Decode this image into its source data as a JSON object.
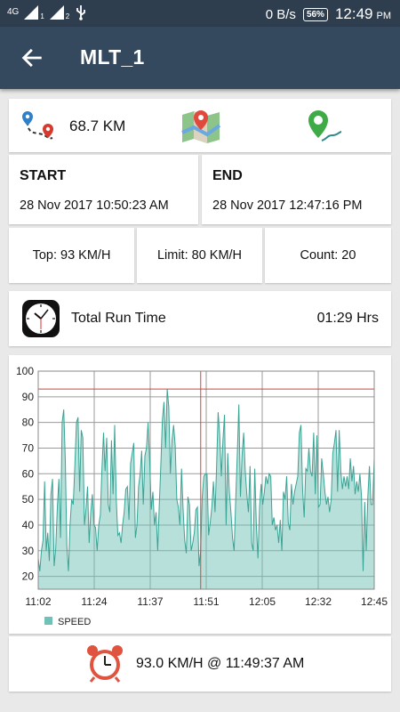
{
  "status_bar": {
    "network": "4G",
    "sim1": "1",
    "sim2": "2",
    "data_rate": "0 B/s",
    "battery": "56%",
    "time": "12:49",
    "ampm": "PM"
  },
  "app_bar": {
    "title": "MLT_1",
    "back_icon": "arrow-left-icon"
  },
  "summary": {
    "distance": "68.7 KM",
    "route_icon": "route-pins-icon",
    "map_icon": "map-pin-icon",
    "location_icon": "location-path-icon"
  },
  "trip": {
    "start_label": "START",
    "start_time": "28 Nov 2017 10:50:23 AM",
    "end_label": "END",
    "end_time": "28 Nov 2017 12:47:16 PM"
  },
  "stats": {
    "top": "Top: 93 KM/H",
    "limit": "Limit: 80 KM/H",
    "count": "Count: 20"
  },
  "run_time": {
    "label": "Total Run Time",
    "value": "01:29 Hrs",
    "icon": "clock-icon"
  },
  "chart_data": {
    "type": "area",
    "series": [
      {
        "name": "SPEED",
        "color": "#6fc2b5"
      }
    ],
    "x_ticks": [
      "11:02",
      "11:24",
      "11:37",
      "11:51",
      "12:05",
      "12:32",
      "12:45"
    ],
    "y_ticks": [
      20,
      30,
      40,
      50,
      60,
      70,
      80,
      90,
      100
    ],
    "ylim": [
      15,
      100
    ],
    "limit_line": 93,
    "marker_x": "11:49:37",
    "legend": "SPEED",
    "legend_position": "bottom-left",
    "values": [
      27,
      22,
      30,
      34,
      57,
      30,
      37,
      26,
      52,
      58,
      24,
      31,
      47,
      58,
      35,
      80,
      85,
      65,
      32,
      22,
      40,
      50,
      48,
      63,
      80,
      82,
      53,
      77,
      74,
      40,
      46,
      55,
      33,
      45,
      52,
      40,
      39,
      30,
      40,
      44,
      62,
      76,
      61,
      74,
      48,
      45,
      73,
      52,
      79,
      50,
      36,
      37,
      33,
      40,
      45,
      54,
      55,
      42,
      64,
      68,
      72,
      35,
      40,
      55,
      60,
      69,
      48,
      67,
      70,
      80,
      65,
      46,
      53,
      40,
      45,
      30,
      48,
      63,
      81,
      88,
      70,
      93,
      86,
      60,
      73,
      79,
      71,
      50,
      47,
      40,
      62,
      46,
      34,
      29,
      51,
      48,
      30,
      33,
      37,
      46,
      47,
      24,
      30,
      51,
      59,
      60,
      60,
      36,
      41,
      47,
      57,
      45,
      62,
      84,
      75,
      59,
      73,
      83,
      40,
      68,
      53,
      45,
      35,
      30,
      49,
      67,
      87,
      51,
      67,
      76,
      61,
      52,
      45,
      63,
      33,
      30,
      62,
      40,
      27,
      47,
      56,
      48,
      53,
      59,
      56,
      60,
      59,
      40,
      43,
      38,
      40,
      33,
      42,
      30,
      53,
      50,
      59,
      41,
      38,
      56,
      48,
      53,
      56,
      59,
      76,
      79,
      54,
      43,
      62,
      61,
      70,
      61,
      59,
      76,
      52,
      75,
      47,
      48,
      66,
      60,
      53,
      48,
      51,
      45,
      50,
      68,
      72,
      77,
      53,
      77,
      61,
      54,
      59,
      55,
      59,
      54,
      66,
      57,
      63,
      52,
      57,
      53,
      60,
      51,
      22,
      49,
      30,
      51,
      63,
      48,
      48,
      66
    ]
  },
  "max_speed": {
    "text": "93.0 KM/H @ 11:49:37 AM",
    "icon": "alarm-clock-icon"
  }
}
